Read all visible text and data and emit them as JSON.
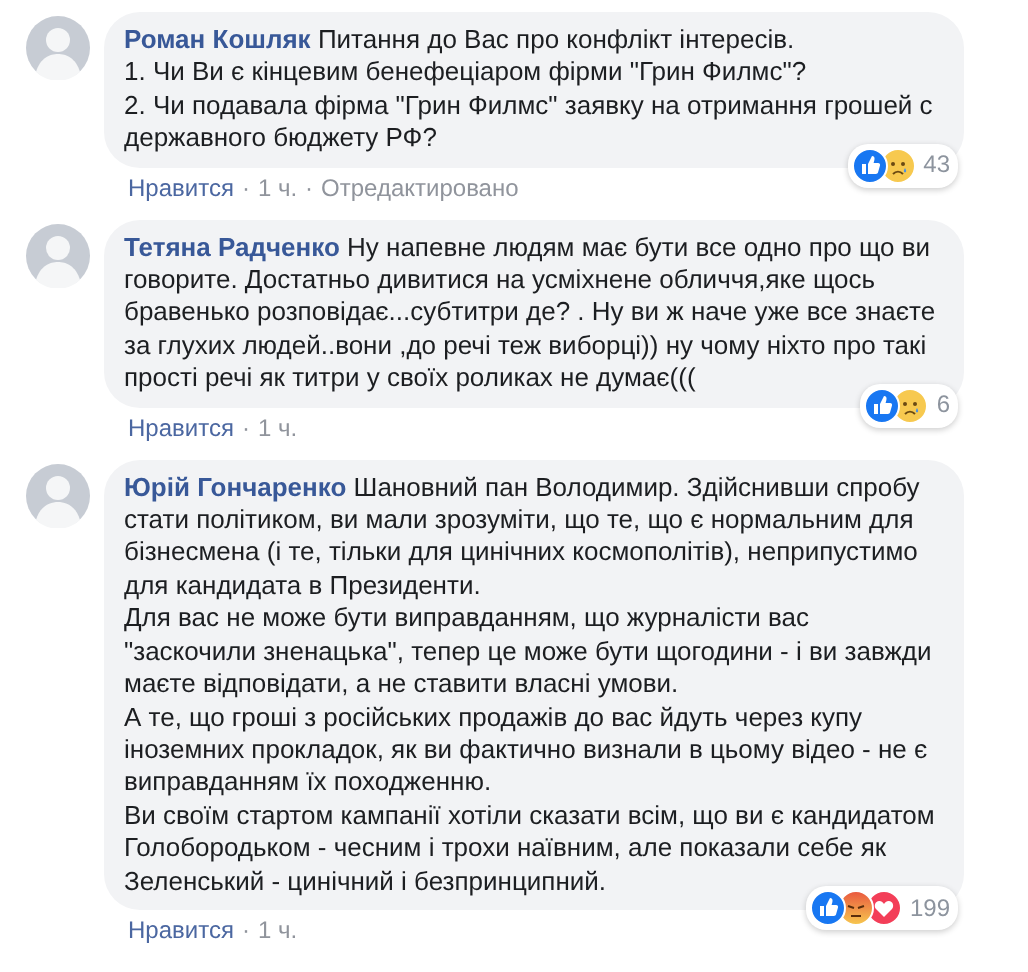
{
  "separator": "·",
  "comments": [
    {
      "author": "Роман Кошляк",
      "paragraphs": [
        "Питання до Вас про конфлікт інтересів.",
        "1. Чи Ви є кінцевим бенефеціаром фірми \"Грин Филмс\"?",
        "2. Чи подавала фірма \"Грин Филмс\" заявку на отримання грошей с державного бюджету РФ?"
      ],
      "reactions": [
        {
          "kind": "like"
        },
        {
          "kind": "sad"
        }
      ],
      "reaction_count": "43",
      "actions": [
        "Нравится",
        "1 ч.",
        "Отредактировано"
      ]
    },
    {
      "author": "Тетяна Радченко",
      "paragraphs": [
        "Ну напевне людям має бути все одно про що ви говорите. Достатньо дивитися на усміхнене обличчя,яке щось бравенько розповідає...субтитри де? . Ну ви ж наче уже все знаєте за глухих людей..вони ,до речі теж виборці)) ну чому ніхто про такі прості речі як титри у своїх роликах не думає((("
      ],
      "reactions": [
        {
          "kind": "like"
        },
        {
          "kind": "sad"
        }
      ],
      "reaction_count": "6",
      "actions": [
        "Нравится",
        "1 ч."
      ]
    },
    {
      "author": "Юрій Гончаренко",
      "paragraphs": [
        "Шановний пан Володимир. Здійснивши спробу стати політиком, ви мали зрозуміти, що те, що є нормальним для бізнесмена (і те, тільки для цинічних космополітів), неприпустимо для кандидата в Президенти.",
        "Для вас не може бути виправданням, що журналісти вас \"заскочили зненацька\", тепер це може бути щогодини - і ви завжди маєте відповідати, а не ставити власні умови.",
        "А те, що гроші з російських продажів до вас йдуть через купу іноземних прокладок, як ви фактично визнали в цьому відео - не є виправданням їх походженню.",
        "Ви своїм стартом кампанії хотіли сказати всім, що ви є кандидатом Голобородьком - чесним і трохи наївним, але показали себе як Зеленський - цинічний і безпринципний."
      ],
      "reactions": [
        {
          "kind": "like"
        },
        {
          "kind": "angry"
        },
        {
          "kind": "love"
        }
      ],
      "reaction_count": "199",
      "actions": [
        "Нравится",
        "1 ч."
      ]
    }
  ]
}
